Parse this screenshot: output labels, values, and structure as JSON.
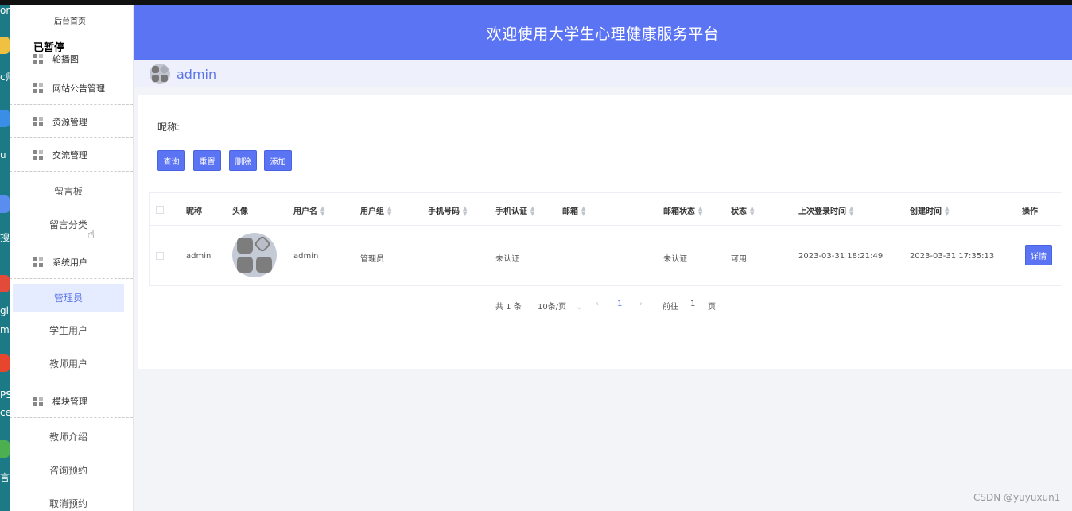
{
  "header": {
    "title": "欢迎使用大学生心理健康服务平台"
  },
  "userbar": {
    "username": "admin"
  },
  "sidebar": {
    "home": "后台首页",
    "overlay_text": "已暂停",
    "groups": [
      {
        "label": "轮播图"
      },
      {
        "label": "网站公告管理"
      },
      {
        "label": "资源管理"
      },
      {
        "label": "交流管理"
      },
      {
        "label": "系统用户"
      },
      {
        "label": "模块管理"
      }
    ],
    "items": [
      {
        "label": "留言板"
      },
      {
        "label": "留言分类"
      },
      {
        "label": "管理员",
        "active": true
      },
      {
        "label": "学生用户"
      },
      {
        "label": "教师用户"
      },
      {
        "label": "教师介绍"
      },
      {
        "label": "咨询预约"
      },
      {
        "label": "取消预约"
      }
    ]
  },
  "desktop": {
    "fragments": [
      "or",
      "c师",
      "u",
      "搜",
      "gl",
      "m",
      "PS",
      "ce",
      "言"
    ]
  },
  "search": {
    "label": "昵称:",
    "value": "",
    "placeholder": ""
  },
  "buttons": {
    "query": "查询",
    "reset": "重置",
    "delete": "删除",
    "add": "添加"
  },
  "table": {
    "columns": [
      "昵称",
      "头像",
      "用户名",
      "用户组",
      "手机号码",
      "手机认证",
      "邮箱",
      "邮箱状态",
      "状态",
      "上次登录时间",
      "创建时间",
      "操作"
    ],
    "rows": [
      {
        "nickname": "admin",
        "username": "admin",
        "group": "管理员",
        "phone": "",
        "phone_verified": "未认证",
        "email": "",
        "email_status": "未认证",
        "status": "可用",
        "last_login": "2023-03-31 18:21:49",
        "created": "2023-03-31 17:35:13",
        "action": "详情"
      }
    ]
  },
  "pagination": {
    "total": "共 1 条",
    "page_size": "10条/页",
    "current": "1",
    "goto_prefix": "前往",
    "goto_value": "1",
    "goto_suffix": "页"
  },
  "watermark": "CSDN @yuyuxun1",
  "colors": {
    "primary": "#5b74f4",
    "header_bg": "#5b74f4",
    "active_menu_bg": "#e6ecff"
  }
}
